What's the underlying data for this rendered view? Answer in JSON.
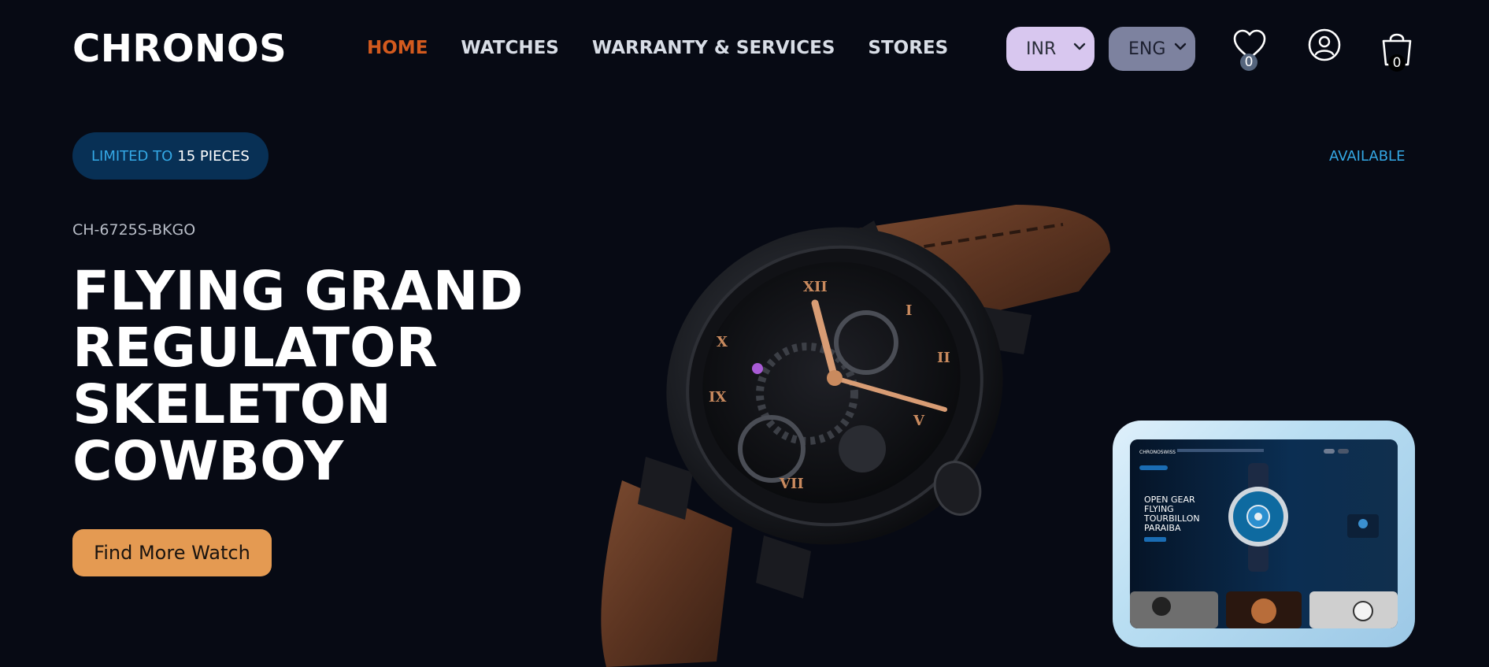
{
  "header": {
    "brand": "CHRONOS",
    "nav": [
      {
        "label": "HOME",
        "active": true
      },
      {
        "label": "WATCHES",
        "active": false
      },
      {
        "label": "WARRANTY & SERVICES",
        "active": false
      },
      {
        "label": "STORES",
        "active": false
      }
    ],
    "currency": {
      "selected": "INR"
    },
    "language": {
      "selected": "ENG"
    },
    "wishlist_count": "0",
    "cart_count": "0",
    "icons": {
      "wishlist": "heart-icon",
      "account": "user-circle-icon",
      "cart": "shopping-bag-icon",
      "dropdown": "chevron-down-icon"
    }
  },
  "hero": {
    "limited_lead": "LIMITED TO",
    "limited_count": "15 PIECES",
    "availability": "AVAILABLE",
    "model_code": "CH-6725S-BKGO",
    "title_lines": [
      "FLYING GRAND",
      "REGULATOR",
      "SKELETON",
      "COWBOY"
    ],
    "cta_label": "Find More Watch"
  },
  "preview": {
    "brand": "CHRONOSWISS",
    "title_lines": [
      "OPEN GEAR",
      "FLYING",
      "TOURBILLON",
      "PARAIBA"
    ]
  },
  "colors": {
    "background": "#070a14",
    "accent_active_nav": "#d35a1e",
    "cta": "#e49a52",
    "info_blue": "#34a8e5",
    "pill_bg": "#083055",
    "currency_bg": "#d8c7ef",
    "language_bg": "#7d829f"
  }
}
